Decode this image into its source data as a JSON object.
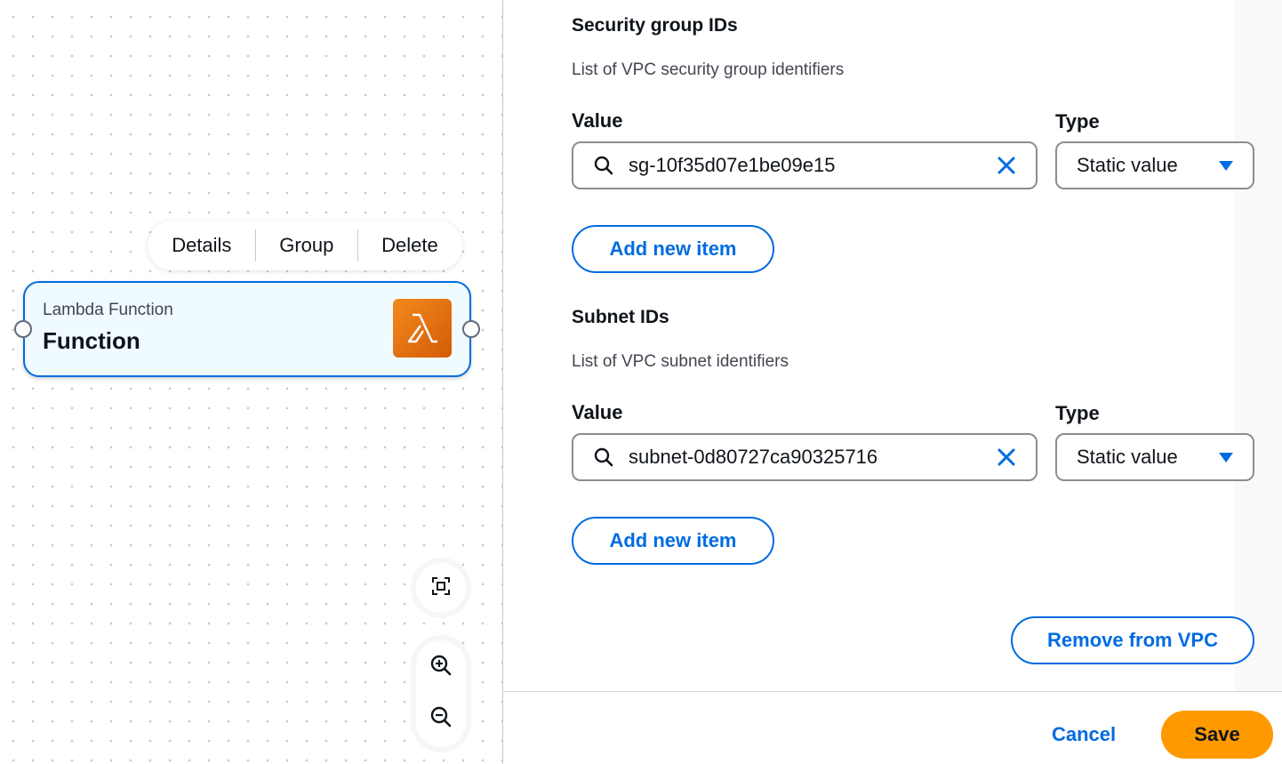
{
  "canvas": {
    "node_toolbar": {
      "details": "Details",
      "group": "Group",
      "delete": "Delete"
    },
    "node": {
      "subtitle": "Lambda Function",
      "title": "Function",
      "icon": "lambda-icon"
    },
    "controls": {
      "fit_icon": "fit-view-icon",
      "zoom_in_icon": "zoom-in-icon",
      "zoom_out_icon": "zoom-out-icon"
    }
  },
  "form": {
    "security_groups": {
      "title": "Security group IDs",
      "description": "List of VPC security group identifiers",
      "value_label": "Value",
      "type_label": "Type",
      "value": "sg-10f35d07e1be09e15",
      "type": "Static value",
      "add_label": "Add new item"
    },
    "subnets": {
      "title": "Subnet IDs",
      "description": "List of VPC subnet identifiers",
      "value_label": "Value",
      "type_label": "Type",
      "value": "subnet-0d80727ca90325716",
      "type": "Static value",
      "add_label": "Add new item"
    },
    "remove_label": "Remove from VPC"
  },
  "footer": {
    "cancel": "Cancel",
    "save": "Save"
  },
  "colors": {
    "accent": "#006ce0",
    "save": "#ff9900",
    "lambda": "#e8731a",
    "node_bg": "#f0fbff"
  }
}
